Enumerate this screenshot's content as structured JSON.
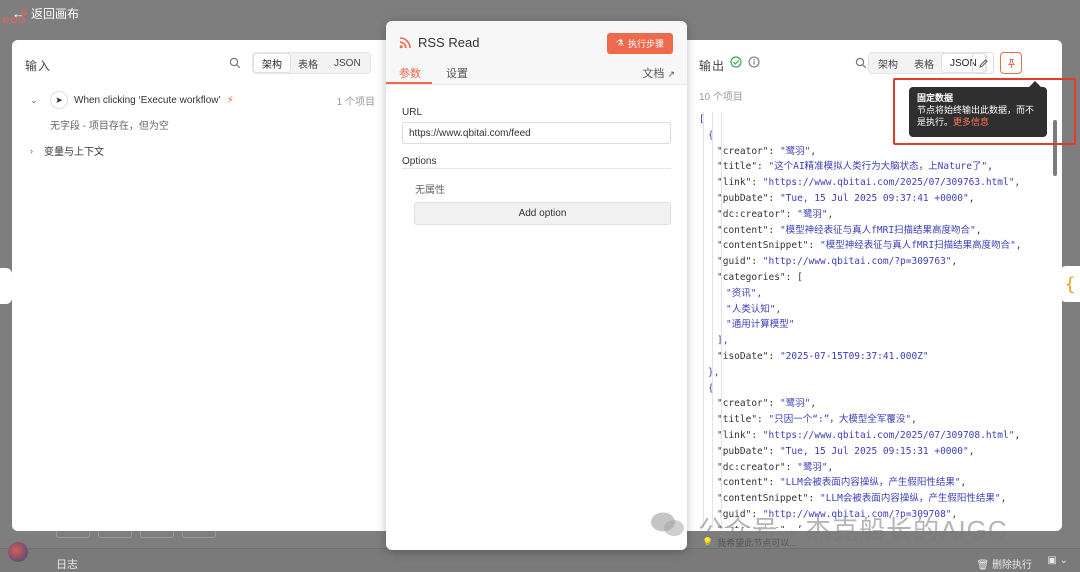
{
  "topbar": {
    "back_label": "返回画布"
  },
  "input_pane": {
    "title": "输入",
    "tabs": [
      "架构",
      "表格",
      "JSON"
    ],
    "active_tab": "架构",
    "trigger_name": "When clicking ‘Execute workflow’",
    "trigger_count": "1 个项目",
    "no_fields_text": "无字段 - 项目存在，但为空",
    "vars_label": "变量与上下文"
  },
  "node": {
    "title": "RSS Read",
    "execute_label": "执行步骤",
    "tabs": [
      "参数",
      "设置"
    ],
    "active_tab": "参数",
    "docs_label": "文档",
    "url_label": "URL",
    "url_value": "https://www.qbitai.com/feed",
    "options_label": "Options",
    "no_properties": "无属性",
    "add_option_label": "Add option"
  },
  "output_pane": {
    "title": "输出",
    "tabs": [
      "架构",
      "表格",
      "JSON"
    ],
    "active_tab": "JSON",
    "items_count": "10 个项目",
    "tooltip": {
      "title": "固定数据",
      "body": "节点将始终输出此数据，而不是执行。",
      "link": "更多信息"
    },
    "json_lines": [
      {
        "i": 0,
        "t": "["
      },
      {
        "i": 1,
        "t": "{"
      },
      {
        "i": 2,
        "k": "\"creator\"",
        "v": "\"鹭羽\"",
        "c": ","
      },
      {
        "i": 2,
        "k": "\"title\"",
        "v": "\"这个AI精准模拟人类行为大脑状态，上Nature了\"",
        "c": ","
      },
      {
        "i": 2,
        "k": "\"link\"",
        "v": "\"https://www.qbitai.com/2025/07/309763.html\"",
        "c": ","
      },
      {
        "i": 2,
        "k": "\"pubDate\"",
        "v": "\"Tue, 15 Jul 2025 09:37:41 +0000\"",
        "c": ","
      },
      {
        "i": 2,
        "k": "\"dc:creator\"",
        "v": "\"鹭羽\"",
        "c": ","
      },
      {
        "i": 2,
        "k": "\"content\"",
        "v": "\"模型神经表征与真人fMRI扫描结果高度吻合\"",
        "c": ","
      },
      {
        "i": 2,
        "k": "\"contentSnippet\"",
        "v": "\"模型神经表征与真人fMRI扫描结果高度吻合\"",
        "c": ","
      },
      {
        "i": 2,
        "k": "\"guid\"",
        "v": "\"http://www.qbitai.com/?p=309763\"",
        "c": ","
      },
      {
        "i": 2,
        "k": "\"categories\"",
        "v": "[",
        "c": ""
      },
      {
        "i": 3,
        "t": "\"资讯\",",
        "s": true
      },
      {
        "i": 3,
        "t": "\"人类认知\",",
        "s": true
      },
      {
        "i": 3,
        "t": "\"通用计算模型\"",
        "s": true
      },
      {
        "i": 2,
        "t": "],"
      },
      {
        "i": 2,
        "k": "\"isoDate\"",
        "v": "\"2025-07-15T09:37:41.000Z\"",
        "c": ""
      },
      {
        "i": 1,
        "t": "},"
      },
      {
        "i": 1,
        "t": "{"
      },
      {
        "i": 2,
        "k": "\"creator\"",
        "v": "\"鹭羽\"",
        "c": ","
      },
      {
        "i": 2,
        "k": "\"title\"",
        "v": "\"只因一个“:”，大模型全军覆没\"",
        "c": ","
      },
      {
        "i": 2,
        "k": "\"link\"",
        "v": "\"https://www.qbitai.com/2025/07/309708.html\"",
        "c": ","
      },
      {
        "i": 2,
        "k": "\"pubDate\"",
        "v": "\"Tue, 15 Jul 2025 09:15:31 +0000\"",
        "c": ","
      },
      {
        "i": 2,
        "k": "\"dc:creator\"",
        "v": "\"鹭羽\"",
        "c": ","
      },
      {
        "i": 2,
        "k": "\"content\"",
        "v": "\"LLM会被表面内容操纵，产生假阳性结果\"",
        "c": ","
      },
      {
        "i": 2,
        "k": "\"contentSnippet\"",
        "v": "\"LLM会被表面内容操纵，产生假阳性结果\"",
        "c": ","
      },
      {
        "i": 2,
        "k": "\"guid\"",
        "v": "\"http://www.qbitai.com/?p=309708\"",
        "c": ","
      },
      {
        "i": 2,
        "k": "\"categories\"",
        "v": "[",
        "c": ""
      }
    ]
  },
  "bottom": {
    "log_label": "日志",
    "delete_exec_label": "删除执行",
    "hint_text": "我希望此节点可以..."
  },
  "watermark": {
    "text": "公众号 · 杰克船长的AIGC"
  },
  "colors": {
    "accent": "#ee6a4c",
    "json_string": "#3e3eb8",
    "highlight_frame": "#e23b2b"
  }
}
